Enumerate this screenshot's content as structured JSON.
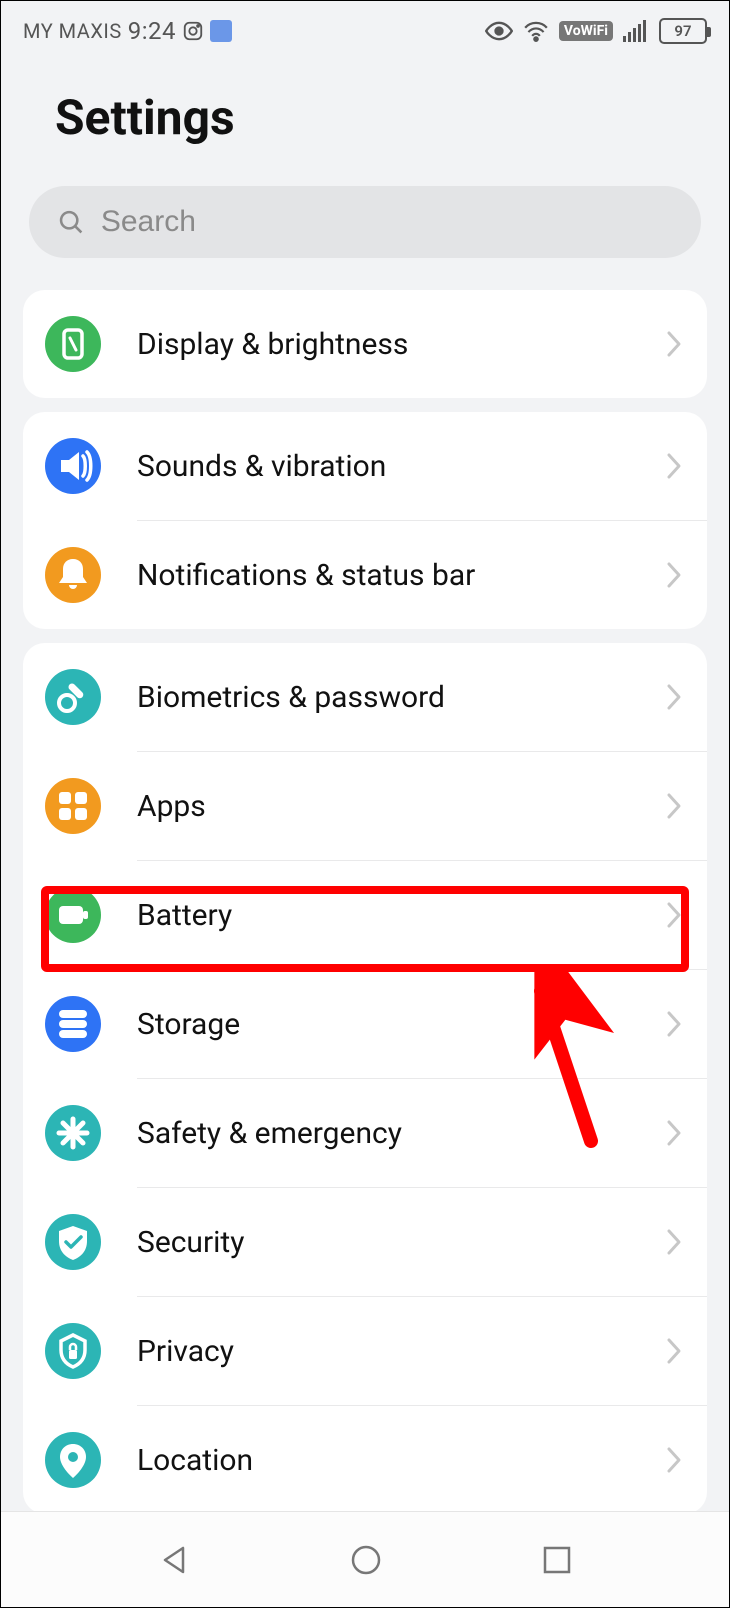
{
  "status": {
    "carrier": "MY MAXIS",
    "time": "9:24",
    "battery": "97"
  },
  "title": "Settings",
  "search": {
    "placeholder": "Search"
  },
  "groups": [
    {
      "rows": [
        {
          "id": "display",
          "label": "Display & brightness",
          "color": "#3db75b"
        }
      ]
    },
    {
      "rows": [
        {
          "id": "sounds",
          "label": "Sounds & vibration",
          "color": "#2e73f5"
        },
        {
          "id": "notifications",
          "label": "Notifications & status bar",
          "color": "#f29a1f"
        }
      ]
    },
    {
      "rows": [
        {
          "id": "biometrics",
          "label": "Biometrics & password",
          "color": "#2cb5b5"
        },
        {
          "id": "apps",
          "label": "Apps",
          "color": "#f29a1f"
        },
        {
          "id": "battery",
          "label": "Battery",
          "color": "#3db75b",
          "highlight": true
        },
        {
          "id": "storage",
          "label": "Storage",
          "color": "#2e73f5"
        },
        {
          "id": "safety",
          "label": "Safety & emergency",
          "color": "#2cb5b5"
        },
        {
          "id": "security",
          "label": "Security",
          "color": "#2cb5b5"
        },
        {
          "id": "privacy",
          "label": "Privacy",
          "color": "#2cb5b5"
        },
        {
          "id": "location",
          "label": "Location",
          "color": "#2cb5b5"
        }
      ]
    }
  ]
}
